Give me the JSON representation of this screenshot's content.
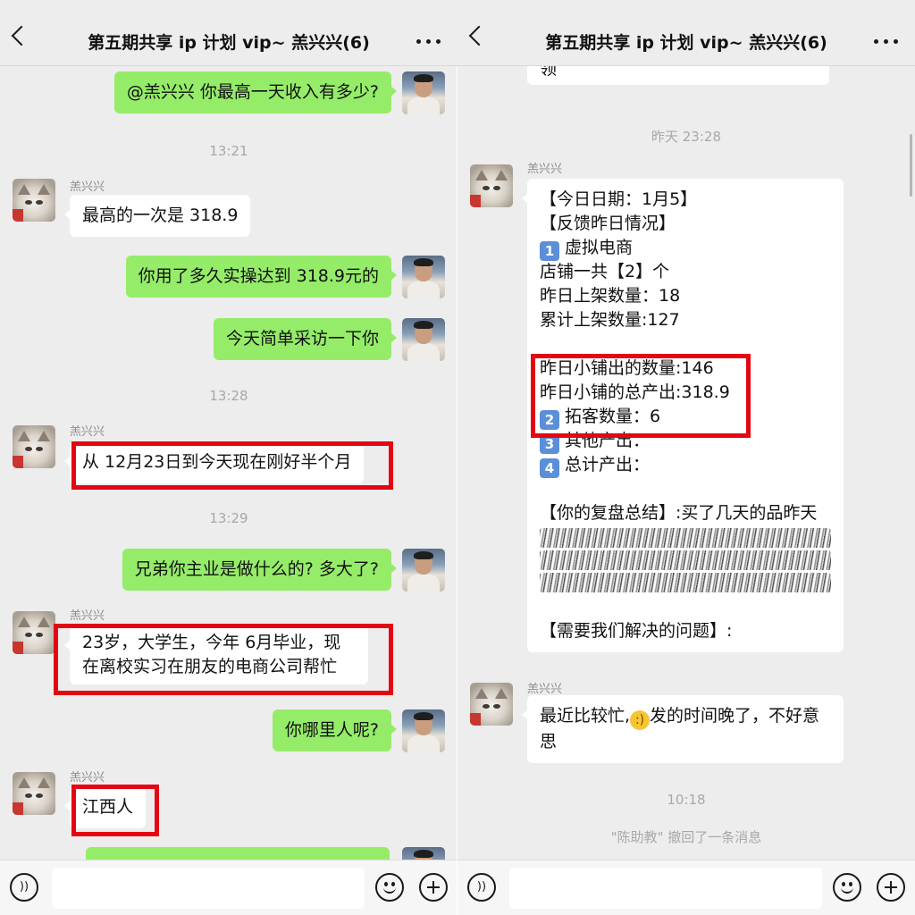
{
  "header": {
    "title": "第五期共享 ip 计划 vip~ 羔兴兴(6)"
  },
  "left": {
    "messages": {
      "m1": "@羔兴兴 你最高一天收入有多少?",
      "t1": "13:21",
      "s1": "羔兴兴",
      "m2": "最高的一次是 318.9",
      "m3": "你用了多久实操达到 318.9元的",
      "m4": "今天简单采访一下你",
      "t2": "13:28",
      "s2": "羔兴兴",
      "m5": "从 12月23日到今天现在刚好半个月",
      "t3": "13:29",
      "m6": "兄弟你主业是做什么的? 多大了?",
      "s3": "羔兴兴",
      "m7": "23岁，大学生，今年 6月毕业，现在离校实习在朋友的电商公司帮忙",
      "m8": "你哪里人呢?",
      "s4": "羔兴兴",
      "m9": "江西人"
    }
  },
  "right": {
    "messages": {
      "m0": "领",
      "t1": "昨天 23:28",
      "s1": "羔兴兴",
      "report": {
        "l1": "【今日日期：1月5】",
        "l2": "【反馈昨日情况】",
        "k1": "1",
        "l3": "虚拟电商",
        "l4": "店铺一共【2】个",
        "l5": "昨日上架数量：18",
        "l6": "累计上架数量:127",
        "l7": "昨日小铺出的数量:146",
        "l8": "昨日小铺的总产出:318.9",
        "k2": "2",
        "l9": "拓客数量：6",
        "k3": "3",
        "l10": "其他产出：",
        "k4": "4",
        "l11": "总计产出：",
        "l12": "【你的复盘总结】:买了几天的品昨天",
        "l13": "【需要我们解决的问题】:"
      },
      "s2": "羔兴兴",
      "m2a": "最近比较忙,",
      "m2b": "发的时间晚了，不好意思",
      "t2": "10:18",
      "recall": "\"陈助教\" 撤回了一条消息"
    }
  },
  "icons": {
    "voice": "voice-icon",
    "emoji": "emoji-icon",
    "plus": "plus-icon"
  },
  "colors": {
    "green_bubble": "#95ec69",
    "highlight_box": "#e30613",
    "background": "#ededed"
  }
}
